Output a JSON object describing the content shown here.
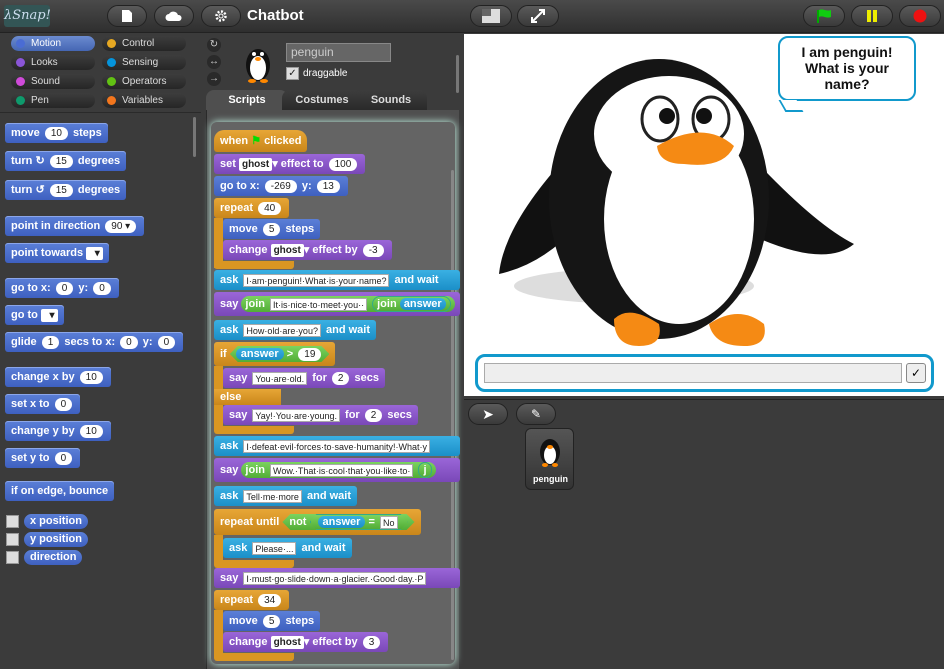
{
  "app": {
    "logo_text": "λSnap!",
    "project_title": "Chatbot"
  },
  "colors": {
    "motion": "#4a6cd4",
    "looks": "#8a55d7",
    "sound": "#cf4ad9",
    "pen": "#0e9a6c",
    "control": "#e6a822",
    "sensing": "#0494dc",
    "operators": "#62c213",
    "variables": "#f3761d",
    "accent": "#1199cc"
  },
  "categories": [
    "Motion",
    "Looks",
    "Sound",
    "Pen",
    "Control",
    "Sensing",
    "Operators",
    "Variables"
  ],
  "palette": {
    "move": "move",
    "move_val": "10",
    "steps": "steps",
    "turn": "turn",
    "turn_val": "15",
    "degrees": "degrees",
    "turn2": "turn",
    "turn2_val": "15",
    "degrees2": "degrees",
    "point_dir": "point in direction",
    "point_dir_val": "90",
    "point_towards": "point towards",
    "goto_xy": "go to x:",
    "goto_x": "0",
    "y_label": "y:",
    "goto_y": "0",
    "goto": "go to",
    "glide": "glide",
    "glide_val": "1",
    "glide_secs": "secs to x:",
    "glide_x": "0",
    "glide_y_label": "y:",
    "glide_y": "0",
    "change_x": "change x by",
    "change_x_val": "10",
    "set_x": "set x to",
    "set_x_val": "0",
    "change_y": "change y by",
    "change_y_val": "10",
    "set_y": "set y to",
    "set_y_val": "0",
    "bounce": "if on edge, bounce",
    "rep_x": "x position",
    "rep_y": "y position",
    "rep_dir": "direction"
  },
  "sprite": {
    "name": "penguin",
    "draggable_label": "draggable",
    "tabs": [
      "Scripts",
      "Costumes",
      "Sounds"
    ]
  },
  "script": [
    {
      "kind": "hat",
      "text": "when",
      "text2": "clicked"
    },
    {
      "kind": "looks",
      "text": "set",
      "dd": "ghost",
      "text2": "effect to",
      "val": "100"
    },
    {
      "kind": "motion",
      "text": "go to x:",
      "val": "-269",
      "text2": "y:",
      "val2": "13"
    },
    {
      "kind": "control",
      "text": "repeat",
      "val": "40"
    },
    {
      "kind": "motion",
      "text": "move",
      "val": "5",
      "text2": "steps"
    },
    {
      "kind": "looks",
      "text": "change",
      "dd": "ghost",
      "text2": "effect by",
      "val": "-3"
    },
    {
      "kind": "sensing",
      "text": "ask",
      "str": "I·am·penguin!·What·is·your·name?",
      "text2": "and wait"
    },
    {
      "kind": "looks",
      "text": "say",
      "join": "join",
      "str": "It·is·nice·to·meet·you··",
      "join2": "join",
      "ans": "answer"
    },
    {
      "kind": "sensing",
      "text": "ask",
      "str": "How·old·are·you?",
      "text2": "and wait"
    },
    {
      "kind": "control",
      "text": "if",
      "ans": "answer",
      "op": ">",
      "val": "19"
    },
    {
      "kind": "looks",
      "text": "say",
      "str": "You·are·old.",
      "text2": "for",
      "val": "2",
      "text3": "secs"
    },
    {
      "kind": "control",
      "text": "else"
    },
    {
      "kind": "looks",
      "text": "say",
      "str": "Yay!·You·are·young.",
      "text2": "for",
      "val": "2",
      "text3": "secs"
    },
    {
      "kind": "sensing",
      "text": "ask",
      "str": "I·defeat·evil·forces·to·save·humanity!·What·y"
    },
    {
      "kind": "looks",
      "text": "say",
      "join": "join",
      "str": "Wow.·That·is·cool·that·you·like·to·",
      "join2": "j"
    },
    {
      "kind": "sensing",
      "text": "ask",
      "str": "Tell·me·more",
      "text2": "and wait"
    },
    {
      "kind": "control",
      "text": "repeat until",
      "not": "not",
      "ans": "answer",
      "op": "=",
      "str": "No"
    },
    {
      "kind": "sensing",
      "text": "ask",
      "str": "Please·...",
      "text2": "and wait"
    },
    {
      "kind": "looks",
      "text": "say",
      "str": "I·must·go·slide·down·a·glacier.·Good·day.·P"
    },
    {
      "kind": "control",
      "text": "repeat",
      "val": "34"
    },
    {
      "kind": "motion",
      "text": "move",
      "val": "5",
      "text2": "steps"
    },
    {
      "kind": "looks",
      "text": "change",
      "dd": "ghost",
      "text2": "effect by",
      "val": "3"
    }
  ],
  "stage": {
    "speech": "I am penguin! What is your name?",
    "answer_value": ""
  },
  "corral": {
    "sprite_label": "penguin"
  }
}
